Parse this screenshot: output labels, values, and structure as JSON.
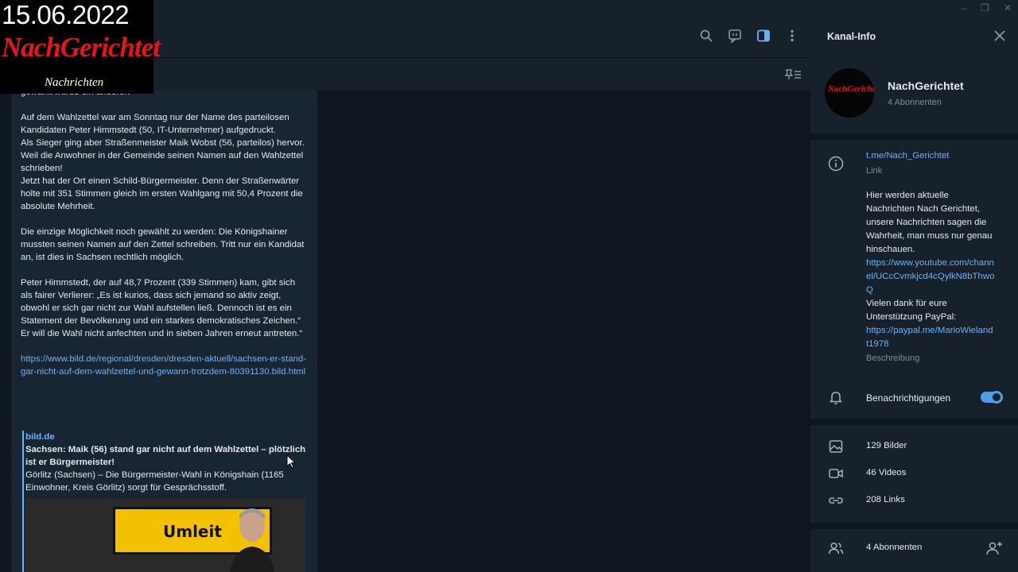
{
  "window": {
    "controls": [
      "–",
      "❐",
      "✕"
    ]
  },
  "chat": {
    "message": {
      "paragraphs": [
        "gewählt wurde ein anderer!",
        "Auf dem Wahlzettel war am Sonntag nur der Name des parteilosen Kandidaten Peter Himmstedt (50, IT-Unternehmer) aufgedruckt.\nAls Sieger ging aber Straßenmeister Maik Wobst (56, parteilos) hervor. Weil die Anwohner in der Gemeinde seinen Namen auf den Wahlzettel schrieben!\nJetzt hat der Ort einen Schild-Bürgermeister. Denn der Straßenwärter holte mit 351 Stimmen gleich im ersten Wahlgang mit 50,4 Prozent die absolute Mehrheit.",
        "Die einzige Möglichkeit noch gewählt zu werden: Die Königshainer mussten seinen Namen auf den Zettel schreiben. Tritt nur ein Kandidat an, ist dies in Sachsen rechtlich möglich.",
        "Peter Himmstedt, der auf 48,7 Prozent (339 Stimmen) kam, gibt sich als fairer Verlierer: „Es ist kurios, dass sich jemand so aktiv zeigt, obwohl er sich gar nicht zur Wahl aufstellen ließ. Dennoch ist es ein Statement der Bevölkerung und ein starkes demokratisches Zeichen.“\nEr will die Wahl nicht anfechten und in sieben Jahren erneut antreten.“"
      ],
      "url": "https://www.bild.de/regional/dresden/dresden-aktuell/sachsen-er-stand-gar-nicht-auf-dem-wahlzettel-und-gewann-trotzdem-80391130.bild.html",
      "preview": {
        "site": "bild.de",
        "title": "Sachsen: Maik (56) stand gar nicht auf dem Wahlzettel – plötzlich ist er Bürgermeister!",
        "description": "Görlitz (Sachsen) – Die Bürgermeister-Wahl in Königshain (1165 Einwohner, Kreis Görlitz) sorgt für Gesprächsstoff.",
        "image_sign_text": "Umleit"
      }
    }
  },
  "logo": {
    "date": "15.06.2022",
    "name": "NachGerichtet",
    "sub": "Nachrichten"
  },
  "info_panel": {
    "title": "Kanal-Info",
    "channel_name": "NachGerichtet",
    "subscribers_line": "4 Abonnenten",
    "link": "t.me/Nach_Gerichtet",
    "link_label": "Link",
    "description": "Hier werden aktuelle Nachrichten Nach Gerichtet, unsere Nachrichten sagen die Wahrheit, man muss nur genau hinschauen.",
    "description_link1": "https://www.youtube.com/channel/UCcCvmkjcd4cQylkN8bThwoQ",
    "description_text2": "Vielen dank für eure Unterstützung PayPal:",
    "description_link2": "https://paypal.me/MarioWielandt1978",
    "description_label": "Beschreibung",
    "notifications_label": "Benachrichtigungen",
    "notifications_on": true,
    "stats": {
      "photos": "129 Bilder",
      "videos": "46 Videos",
      "links": "208 Links",
      "members": "4 Abonnenten"
    }
  },
  "colors": {
    "background": "#0e1621",
    "panel": "#17212b",
    "bubble": "#182533",
    "link": "#6ab3f3",
    "accent": "#4f9de5",
    "logo_red": "#e8141b"
  },
  "icons": [
    "search-icon",
    "video-chat-icon",
    "sidebar-toggle-icon",
    "more-icon",
    "pinned-list-icon",
    "close-icon",
    "info-icon",
    "bell-icon",
    "photo-icon",
    "video-icon",
    "link-icon",
    "users-icon",
    "add-user-icon"
  ]
}
